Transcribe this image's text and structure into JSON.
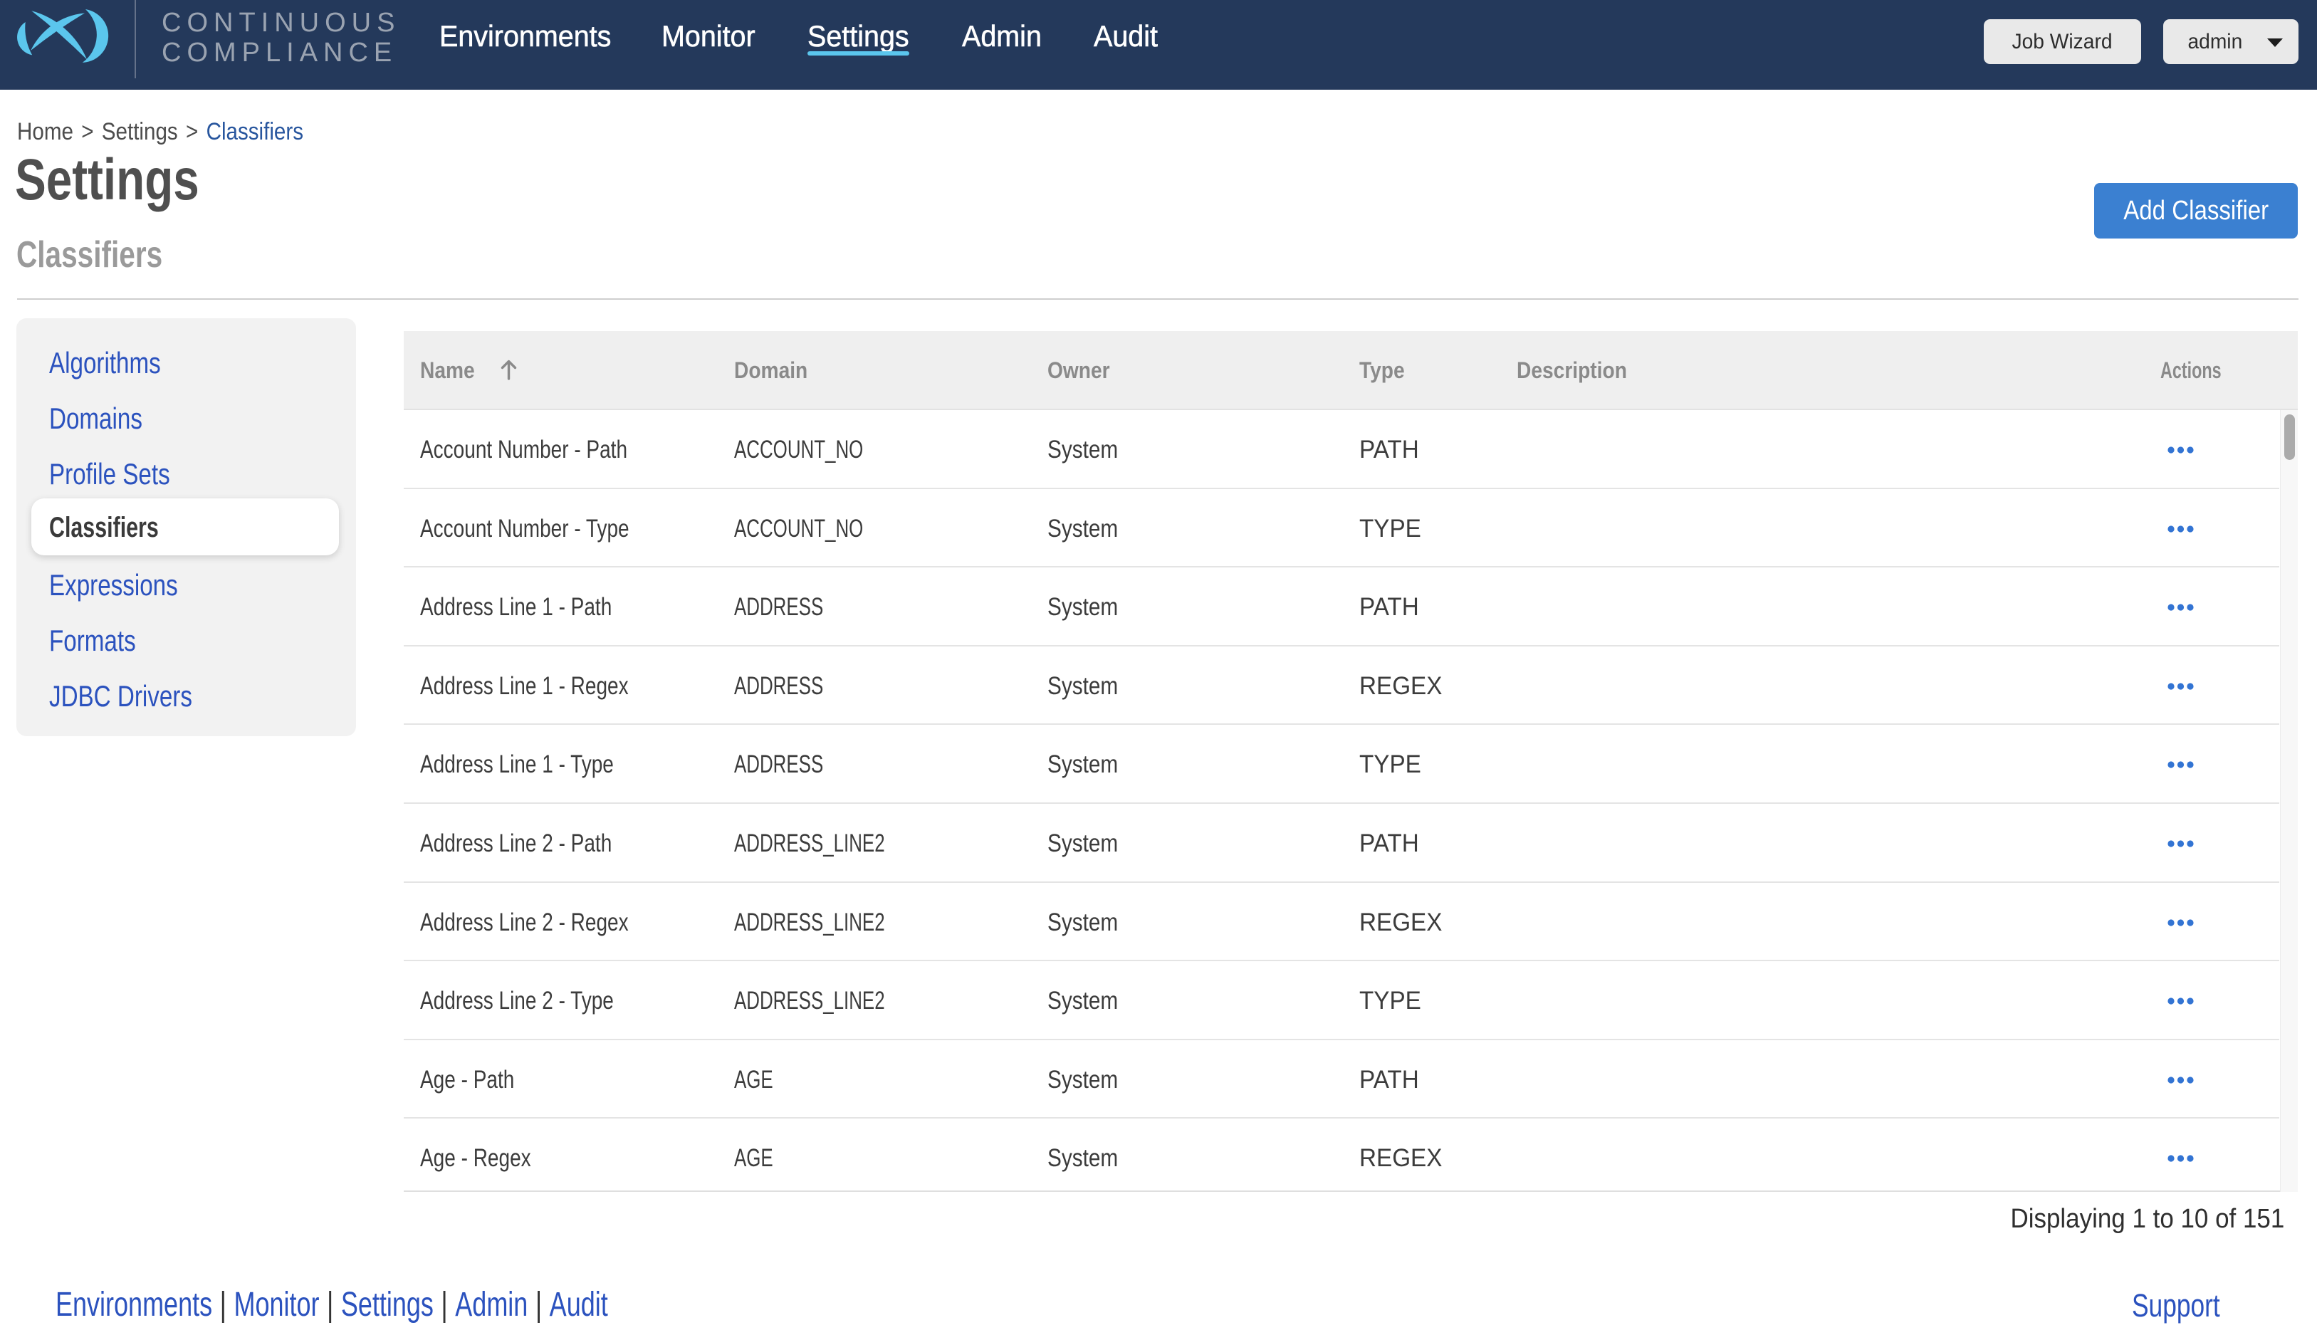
{
  "colors": {
    "navbar-bg": "#24395B",
    "accent-lightblue": "#5BC6ED",
    "brand-gray": "#9AA3B1",
    "link-blue": "#2B52BE",
    "breadcrumb-link": "#28569E",
    "button-blue": "#3B80D1",
    "actions-dots-blue": "#3374D3"
  },
  "navbar": {
    "brand_line1": "CONTINUOUS",
    "brand_line2": "COMPLIANCE",
    "items": [
      {
        "label": "Environments"
      },
      {
        "label": "Monitor"
      },
      {
        "label": "Settings",
        "active": true
      },
      {
        "label": "Admin"
      },
      {
        "label": "Audit"
      }
    ],
    "job_wizard_label": "Job Wizard",
    "user_label": "admin"
  },
  "breadcrumb": {
    "items": [
      "Home",
      "Settings",
      "Classifiers"
    ],
    "separator": ">"
  },
  "page": {
    "title": "Settings",
    "section_title": "Classifiers"
  },
  "toolbar": {
    "add_classifier_label": "Add Classifier"
  },
  "sidebar": {
    "items": [
      {
        "label": "Algorithms"
      },
      {
        "label": "Domains"
      },
      {
        "label": "Profile Sets"
      },
      {
        "label": "Classifiers",
        "active": true
      },
      {
        "label": "Expressions"
      },
      {
        "label": "Formats"
      },
      {
        "label": "JDBC Drivers"
      }
    ]
  },
  "table": {
    "columns": [
      "Name",
      "Domain",
      "Owner",
      "Type",
      "Description",
      "Actions"
    ],
    "sorted_by": "Name",
    "sort_direction": "ascending",
    "rows": [
      {
        "name": "Account Number - Path",
        "domain": "ACCOUNT_NO",
        "owner": "System",
        "type": "PATH",
        "description": ""
      },
      {
        "name": "Account Number - Type",
        "domain": "ACCOUNT_NO",
        "owner": "System",
        "type": "TYPE",
        "description": ""
      },
      {
        "name": "Address Line 1 - Path",
        "domain": "ADDRESS",
        "owner": "System",
        "type": "PATH",
        "description": ""
      },
      {
        "name": "Address Line 1 - Regex",
        "domain": "ADDRESS",
        "owner": "System",
        "type": "REGEX",
        "description": ""
      },
      {
        "name": "Address Line 1 - Type",
        "domain": "ADDRESS",
        "owner": "System",
        "type": "TYPE",
        "description": ""
      },
      {
        "name": "Address Line 2 - Path",
        "domain": "ADDRESS_LINE2",
        "owner": "System",
        "type": "PATH",
        "description": ""
      },
      {
        "name": "Address Line 2 - Regex",
        "domain": "ADDRESS_LINE2",
        "owner": "System",
        "type": "REGEX",
        "description": ""
      },
      {
        "name": "Address Line 2 - Type",
        "domain": "ADDRESS_LINE2",
        "owner": "System",
        "type": "TYPE",
        "description": ""
      },
      {
        "name": "Age - Path",
        "domain": "AGE",
        "owner": "System",
        "type": "PATH",
        "description": ""
      },
      {
        "name": "Age - Regex",
        "domain": "AGE",
        "owner": "System",
        "type": "REGEX",
        "description": ""
      }
    ]
  },
  "pagination": {
    "text": "Displaying 1 to 10 of 151"
  },
  "footer": {
    "links": [
      "Environments",
      "Monitor",
      "Settings",
      "Admin",
      "Audit"
    ],
    "separator": "|",
    "support_label": "Support"
  }
}
